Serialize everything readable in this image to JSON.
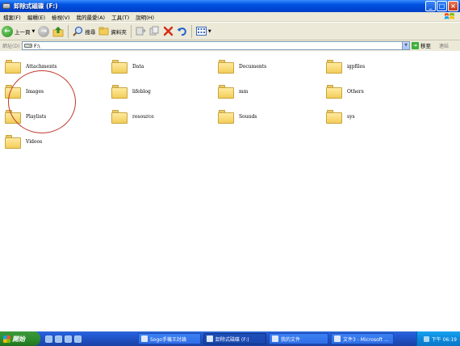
{
  "window": {
    "title": "卸除式磁碟 (F:)"
  },
  "menu": {
    "items": [
      "檔案(F)",
      "編輯(E)",
      "檢視(V)",
      "我的最愛(A)",
      "工具(T)",
      "說明(H)"
    ]
  },
  "toolbar": {
    "back_label": "上一頁",
    "search_label": "搜尋",
    "folders_label": "資料夾"
  },
  "address": {
    "label": "網址(D)",
    "value": "F:\\",
    "go_label": "移至",
    "links_label": "連結"
  },
  "folders": [
    "Attachments",
    "Data",
    "Documents",
    "igpfiles",
    "Images",
    "lifeblog",
    "mm",
    "Others",
    "Playlists",
    "resource",
    "Sounds",
    "sys",
    "Videos"
  ],
  "taskbar": {
    "start_label": "開始",
    "tasks": [
      {
        "label": "Sogo手機王討論",
        "active": false
      },
      {
        "label": "卸除式磁碟 (F:)",
        "active": true
      },
      {
        "label": "我的文件",
        "active": false
      },
      {
        "label": "文件3 - Microsoft ...",
        "active": false
      }
    ],
    "clock": "下午 06:19"
  },
  "colors": {
    "titlebar": "#0054e3",
    "taskbar": "#245edb",
    "start": "#3c9a3c",
    "annotation": "#c0392b"
  }
}
